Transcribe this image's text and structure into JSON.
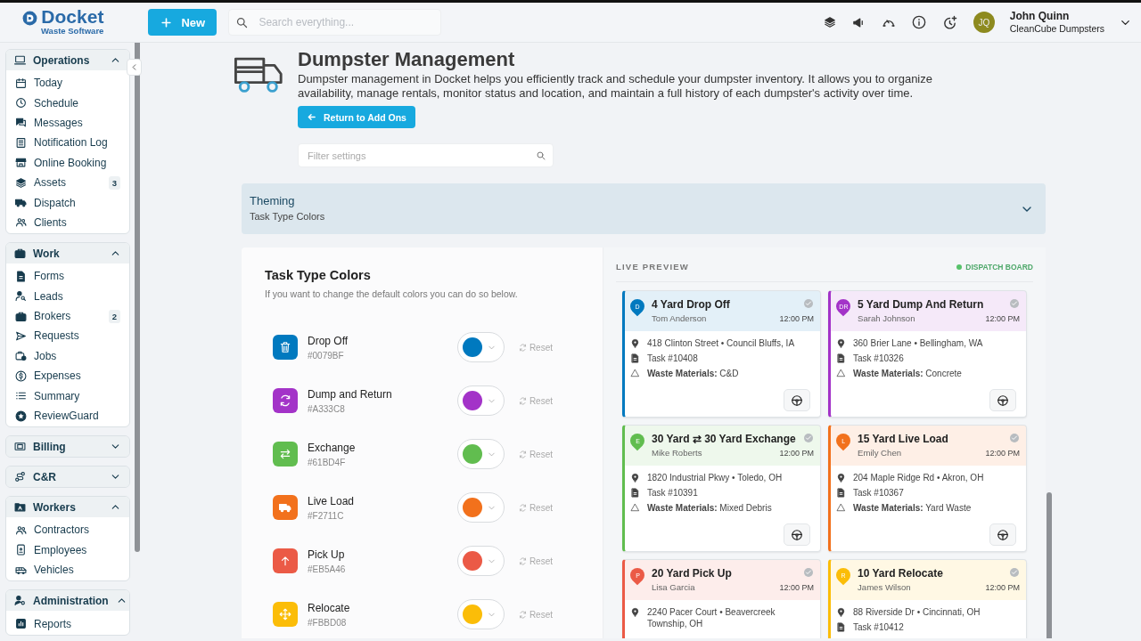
{
  "brand": {
    "name": "Docket",
    "tagline": "Waste Software"
  },
  "new_button": "New",
  "search": {
    "placeholder": "Search everything..."
  },
  "user": {
    "initials": "JQ",
    "name": "John Quinn",
    "company": "CleanCube Dumpsters"
  },
  "sidebar": {
    "sections": [
      {
        "title": "Operations",
        "expanded": true,
        "items": [
          {
            "label": "Today"
          },
          {
            "label": "Schedule"
          },
          {
            "label": "Messages"
          },
          {
            "label": "Notification Log"
          },
          {
            "label": "Online Booking"
          },
          {
            "label": "Assets",
            "badge": "3"
          },
          {
            "label": "Dispatch"
          },
          {
            "label": "Clients"
          }
        ]
      },
      {
        "title": "Work",
        "expanded": true,
        "items": [
          {
            "label": "Forms"
          },
          {
            "label": "Leads"
          },
          {
            "label": "Brokers",
            "badge": "2"
          },
          {
            "label": "Requests"
          },
          {
            "label": "Jobs"
          },
          {
            "label": "Expenses"
          },
          {
            "label": "Summary"
          },
          {
            "label": "ReviewGuard"
          }
        ]
      },
      {
        "title": "Billing",
        "expanded": false
      },
      {
        "title": "C&R",
        "expanded": false
      },
      {
        "title": "Workers",
        "expanded": true,
        "items": [
          {
            "label": "Contractors"
          },
          {
            "label": "Employees"
          },
          {
            "label": "Vehicles"
          }
        ]
      },
      {
        "title": "Administration",
        "expanded": true,
        "items": [
          {
            "label": "Reports"
          }
        ]
      }
    ]
  },
  "page": {
    "title": "Dumpster Management",
    "description": "Dumpster management in Docket helps you efficiently track and schedule your dumpster inventory. It allows you to organize availability, manage rentals, monitor status and location, and maintain a full history of each dumpster's activity over time.",
    "back_button": "Return to Add Ons",
    "filter": {
      "placeholder": "Filter settings"
    }
  },
  "theming": {
    "title": "Theming",
    "subtitle": "Task Type Colors"
  },
  "task_colors": {
    "title": "Task Type Colors",
    "subtitle": "If you want to change the default colors you can do so below.",
    "items": [
      {
        "name": "Drop Off",
        "hex": "#0079BF",
        "color": "#0079bf",
        "reset": "Reset"
      },
      {
        "name": "Dump and Return",
        "hex": "#A333C8",
        "color": "#a333c8",
        "reset": "Reset"
      },
      {
        "name": "Exchange",
        "hex": "#61BD4F",
        "color": "#61bd4f",
        "reset": "Reset"
      },
      {
        "name": "Live Load",
        "hex": "#F2711C",
        "color": "#f2711c",
        "reset": "Reset"
      },
      {
        "name": "Pick Up",
        "hex": "#EB5A46",
        "color": "#eb5a46",
        "reset": "Reset"
      },
      {
        "name": "Relocate",
        "hex": "#FBBD08",
        "color": "#fbbd08",
        "reset": "Reset"
      }
    ]
  },
  "preview": {
    "label": "LIVE PREVIEW",
    "board": "DISPATCH BOARD",
    "cards": [
      {
        "title": "4 Yard Drop Off",
        "initials": "D",
        "customer": "Tom Anderson",
        "time": "12:00 PM",
        "address": "418 Clinton Street • Council Bluffs, IA",
        "task": "Task #10408",
        "waste": "**Waste Materials:** C&D",
        "color": "#0079bf"
      },
      {
        "title": "5 Yard Dump And Return",
        "initials": "DR",
        "customer": "Sarah Johnson",
        "time": "12:00 PM",
        "address": "360 Brier Lane • Bellingham, WA",
        "task": "Task #10326",
        "waste": "**Waste Materials:** Concrete",
        "color": "#a333c8"
      },
      {
        "title": "30 Yard ⇄ 30 Yard Exchange",
        "initials": "E",
        "customer": "Mike Roberts",
        "time": "12:00 PM",
        "address": "1820 Industrial Pkwy • Toledo, OH",
        "task": "Task #10391",
        "waste": "**Waste Materials:** Mixed Debris",
        "color": "#61bd4f"
      },
      {
        "title": "15 Yard Live Load",
        "initials": "L",
        "customer": "Emily Chen",
        "time": "12:00 PM",
        "address": "204 Maple Ridge Rd • Akron, OH",
        "task": "Task #10367",
        "waste": "**Waste Materials:** Yard Waste",
        "color": "#f2711c"
      },
      {
        "title": "20 Yard Pick Up",
        "initials": "P",
        "customer": "Lisa Garcia",
        "time": "12:00 PM",
        "address": "2240 Pacer Court • Beavercreek Township, OH",
        "color": "#eb5a46"
      },
      {
        "title": "10 Yard Relocate",
        "initials": "R",
        "customer": "James Wilson",
        "time": "12:00 PM",
        "address": "88 Riverside Dr • Cincinnati, OH",
        "task": "Task #10412",
        "color": "#fbbd08"
      }
    ]
  }
}
